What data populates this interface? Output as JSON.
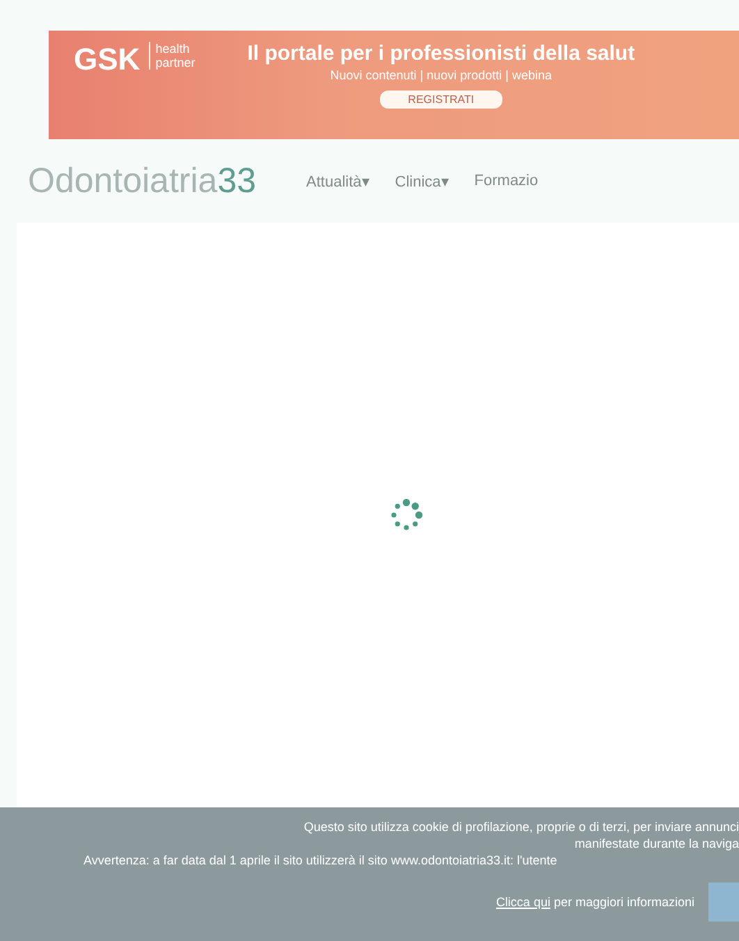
{
  "banner": {
    "brand": "GSK",
    "brand_tagline": "health partner",
    "headline": "Il portale per i professionisti della salut",
    "subline": "Nuovi contenuti | nuovi prodotti | webina",
    "button": "REGISTRATI"
  },
  "header": {
    "logo_light": "Odontoiatria",
    "logo_bold": "33",
    "nav": [
      {
        "label": "Attualità",
        "caret": "▾"
      },
      {
        "label": "Clinica",
        "caret": "▾"
      },
      {
        "label": "Formazio"
      }
    ]
  },
  "cookie_bar": {
    "lines": [
      "Questo sito utilizza cookie di profilazione, proprie o di terzi, per inviare annunci",
      "manifestate durante la naviga",
      "Avvertenza: a far data dal 1 aprile il sito utilizzerà il sito www.odontoiatria33.it: l'utente"
    ],
    "link": "Clicca qui",
    "link_rest": "per maggiori informazioni"
  }
}
